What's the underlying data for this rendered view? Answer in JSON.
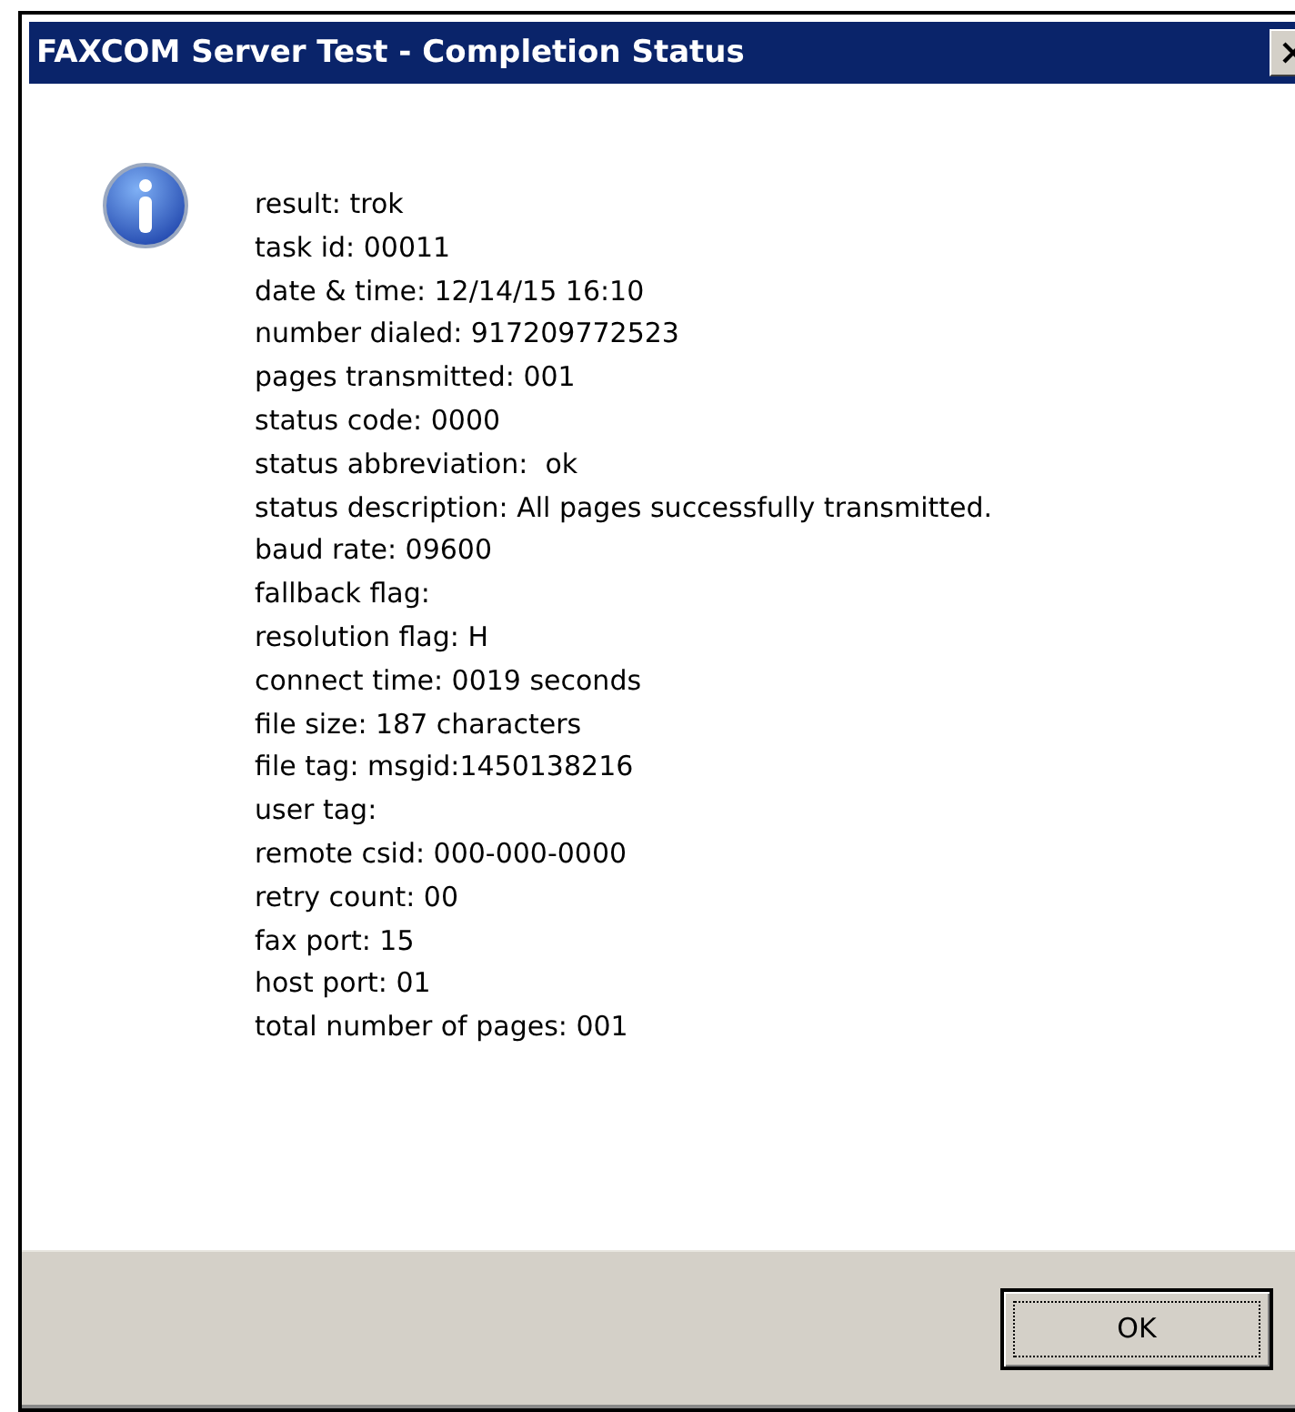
{
  "window": {
    "title": "FAXCOM Server Test - Completion Status"
  },
  "lines": [
    "result: trok",
    "task id: 00011",
    "date & time: 12/14/15 16:10",
    "number dialed: 917209772523",
    "pages transmitted: 001",
    "status code: 0000",
    "status abbreviation:  ok",
    "status description: All pages successfully transmitted.",
    "baud rate: 09600",
    "fallback flag:",
    "resolution flag: H",
    "connect time: 0019 seconds",
    "file size: 187 characters",
    "file tag: msgid:1450138216",
    "user tag:",
    "remote csid: 000-000-0000",
    "retry count: 00",
    "fax port: 15",
    "host port: 01",
    "total number of pages: 001"
  ],
  "buttons": [
    "OK"
  ]
}
